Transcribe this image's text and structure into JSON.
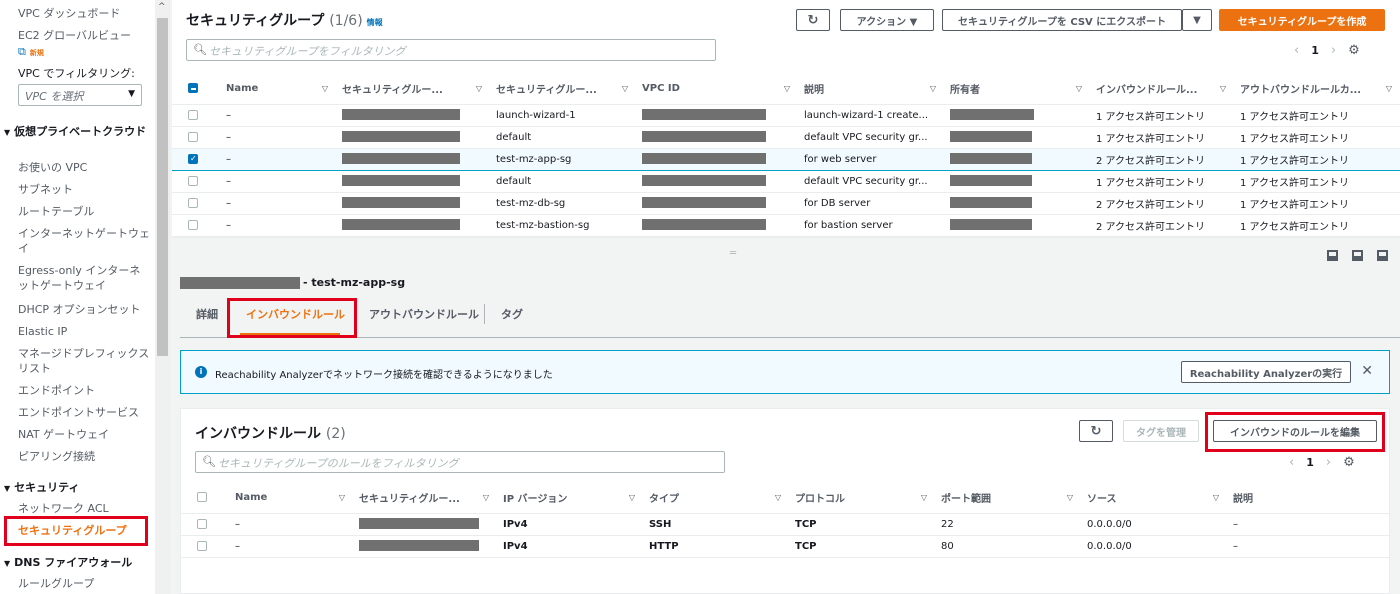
{
  "sidebar": {
    "items_top": [
      "VPC ダッシュボード",
      "EC2 グローバルビュー"
    ],
    "new_badge": "新規",
    "filter_label": "VPC でフィルタリング:",
    "filter_placeholder": "VPC を選択",
    "section_vpc": "仮想プライベートクラウド",
    "vpc_items": [
      "お使いの VPC",
      "サブネット",
      "ルートテーブル",
      "インターネットゲートウェイ",
      "Egress-only インターネットゲートウェイ",
      "DHCP オプションセット",
      "Elastic IP",
      "マネージドプレフィックスリスト",
      "エンドポイント",
      "エンドポイントサービス",
      "NAT ゲートウェイ",
      "ピアリング接続"
    ],
    "section_security": "セキュリティ",
    "security_items": [
      "ネットワーク ACL",
      "セキュリティグループ"
    ],
    "section_dns": "DNS ファイアウォール",
    "dns_items": [
      "ルールグループ"
    ]
  },
  "top": {
    "title": "セキュリティグループ",
    "count": "(1/6)",
    "info": "情報",
    "refresh_icon": "refresh-icon",
    "actions_label": "アクション ▼",
    "export_label": "セキュリティグループを CSV にエクスポート",
    "export_caret": "▼",
    "create_label": "セキュリティグループを作成",
    "filter_placeholder": "セキュリティグループをフィルタリング",
    "page": "1",
    "columns": [
      "Name",
      "セキュリティグルー...",
      "セキュリティグルー...",
      "VPC ID",
      "説明",
      "所有者",
      "インバウンドルール...",
      "アウトバウンドルールカ..."
    ],
    "rows": [
      {
        "name": "–",
        "sg_name": "launch-wizard-1",
        "desc": "launch-wizard-1 create...",
        "in": "1 アクセス許可エントリ",
        "out": "1 アクセス許可エントリ",
        "selected": false
      },
      {
        "name": "–",
        "sg_name": "default",
        "desc": "default VPC security gr...",
        "in": "1 アクセス許可エントリ",
        "out": "1 アクセス許可エントリ",
        "selected": false
      },
      {
        "name": "–",
        "sg_name": "test-mz-app-sg",
        "desc": "for web server",
        "in": "2 アクセス許可エントリ",
        "out": "1 アクセス許可エントリ",
        "selected": true
      },
      {
        "name": "–",
        "sg_name": "default",
        "desc": "default VPC security gr...",
        "in": "1 アクセス許可エントリ",
        "out": "1 アクセス許可エントリ",
        "selected": false
      },
      {
        "name": "–",
        "sg_name": "test-mz-db-sg",
        "desc": "for DB server",
        "in": "2 アクセス許可エントリ",
        "out": "1 アクセス許可エントリ",
        "selected": false
      },
      {
        "name": "–",
        "sg_name": "test-mz-bastion-sg",
        "desc": "for bastion server",
        "in": "2 アクセス許可エントリ",
        "out": "1 アクセス許可エントリ",
        "selected": false
      }
    ]
  },
  "detail": {
    "title_suffix": "- test-mz-app-sg",
    "tabs": [
      "詳細",
      "インバウンドルール",
      "アウトバウンドルール",
      "タグ"
    ]
  },
  "alert": {
    "icon": "info-icon",
    "text": "Reachability Analyzerでネットワーク接続を確認できるようになりました",
    "button": "Reachability Analyzerの実行",
    "close": "✕"
  },
  "rules": {
    "title": "インバウンドルール",
    "count": "(2)",
    "manage_tags": "タグを管理",
    "edit_label": "インバウンドのルールを編集",
    "filter_placeholder": "セキュリティグループのルールをフィルタリング",
    "page": "1",
    "columns": [
      "Name",
      "セキュリティグルー...",
      "IP バージョン",
      "タイプ",
      "プロトコル",
      "ポート範囲",
      "ソース",
      "説明"
    ],
    "rows": [
      {
        "name": "–",
        "ipver": "IPv4",
        "type": "SSH",
        "proto": "TCP",
        "port": "22",
        "source": "0.0.0.0/0",
        "desc": "–"
      },
      {
        "name": "–",
        "ipver": "IPv4",
        "type": "HTTP",
        "proto": "TCP",
        "port": "80",
        "source": "0.0.0.0/0",
        "desc": "–"
      }
    ]
  }
}
